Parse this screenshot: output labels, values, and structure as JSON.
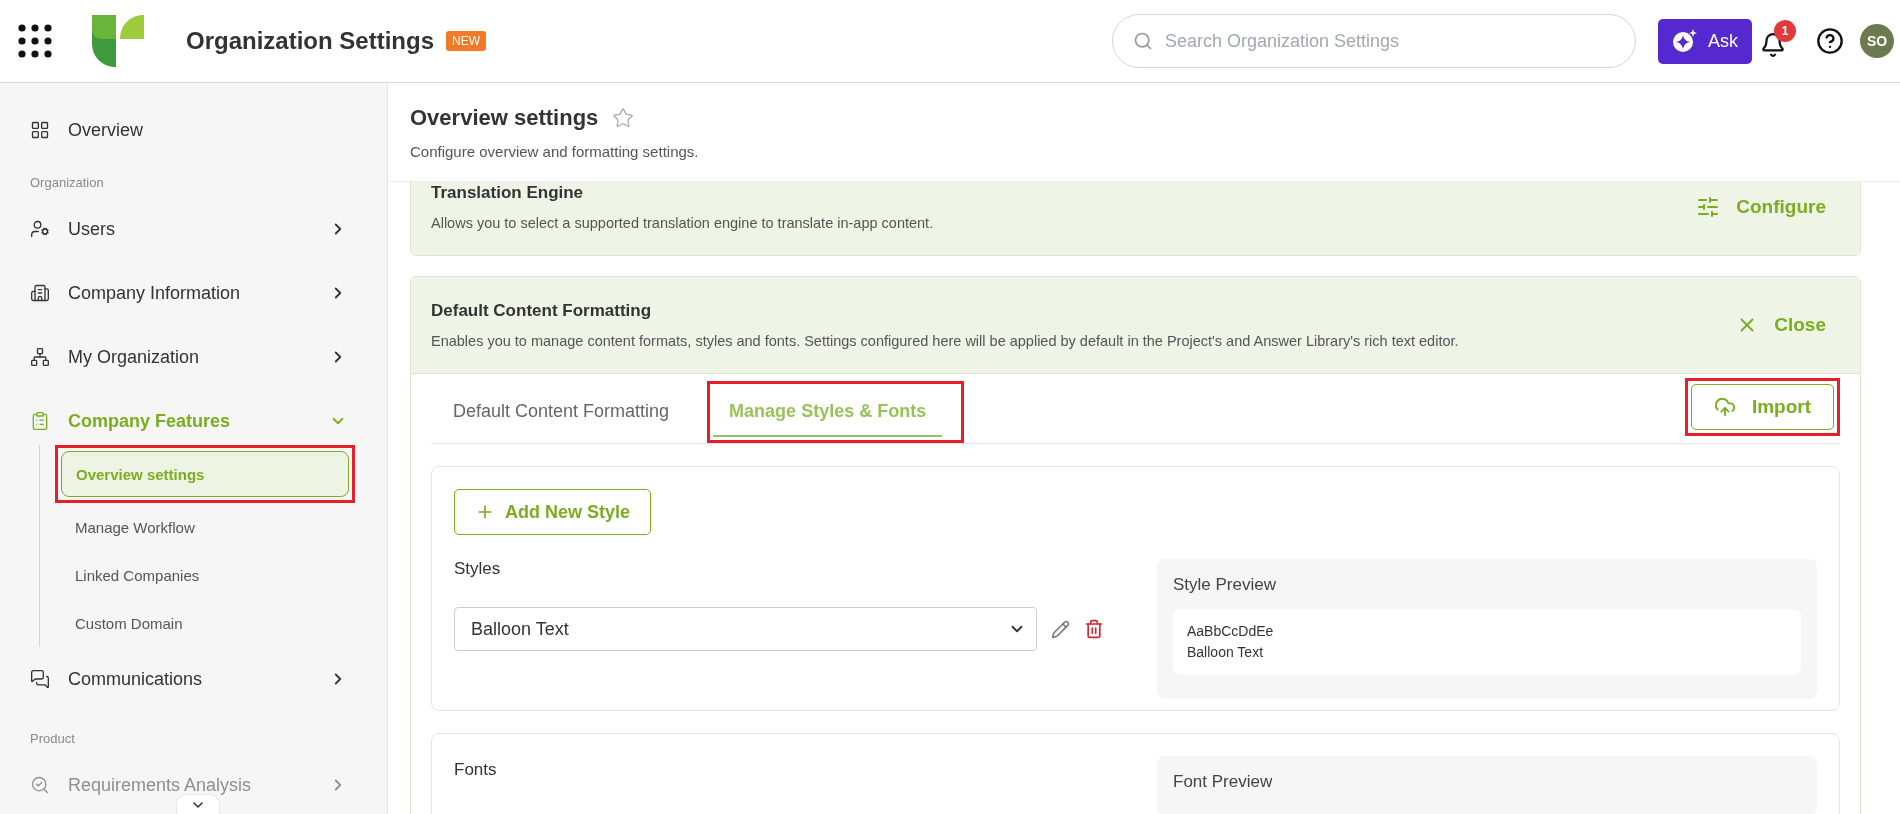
{
  "header": {
    "title": "Organization Settings",
    "badge": "NEW",
    "search": {
      "placeholder": "Search Organization Settings"
    },
    "ask_button": "Ask",
    "notifications": "1",
    "avatar": "SO"
  },
  "sidebar": {
    "items": [
      {
        "kind": "link",
        "label": "Overview",
        "selected": false
      },
      {
        "kind": "section",
        "label": "Organization"
      },
      {
        "kind": "group",
        "label": "Users",
        "selected": false,
        "expanded": false
      },
      {
        "kind": "group",
        "label": "Company Information",
        "selected": false,
        "expanded": false
      },
      {
        "kind": "group",
        "label": "My Organization",
        "selected": false,
        "expanded": false
      },
      {
        "kind": "group",
        "label": "Company Features",
        "selected": true,
        "expanded": true,
        "children": [
          {
            "label": "Overview settings",
            "selected": true,
            "highlighted": true
          },
          {
            "label": "Manage Workflow",
            "selected": false,
            "highlighted": false
          },
          {
            "label": "Linked Companies",
            "selected": false,
            "highlighted": false
          },
          {
            "label": "Custom Domain",
            "selected": false,
            "highlighted": false
          }
        ]
      },
      {
        "kind": "group",
        "label": "Communications",
        "selected": false,
        "expanded": false
      },
      {
        "kind": "section",
        "label": "Product"
      },
      {
        "kind": "group",
        "label": "Requirements Analysis",
        "selected": false,
        "expanded": false,
        "disabled": true
      }
    ]
  },
  "page": {
    "title": "Overview settings",
    "favorite": false,
    "subtitle": "Configure overview and formatting settings."
  },
  "cards": [
    {
      "title": "Translation Engine",
      "description": "Allows you to select a supported translation engine to translate in-app content.",
      "action": "Configure",
      "expanded": false
    },
    {
      "title": "Default Content Formatting",
      "description": "Enables you to manage content formats, styles and fonts. Settings configured here will be applied by default in the Project's and Answer Library's rich text editor.",
      "action": "Close",
      "expanded": true,
      "content": {
        "tabs": [
          {
            "label": "Default Content Formatting",
            "selected": false,
            "highlighted": false
          },
          {
            "label": "Manage Styles & Fonts",
            "selected": true,
            "highlighted": true
          }
        ],
        "import_button": {
          "label": "Import",
          "highlighted": true
        },
        "styles": {
          "add_button": "Add New Style",
          "label": "Styles",
          "value": "Balloon Text",
          "preview_title": "Style Preview",
          "preview_lines": [
            "AaBbCcDdEe",
            "Balloon Text"
          ]
        },
        "fonts": {
          "label": "Fonts",
          "preview_title": "Font Preview"
        }
      }
    }
  ]
}
